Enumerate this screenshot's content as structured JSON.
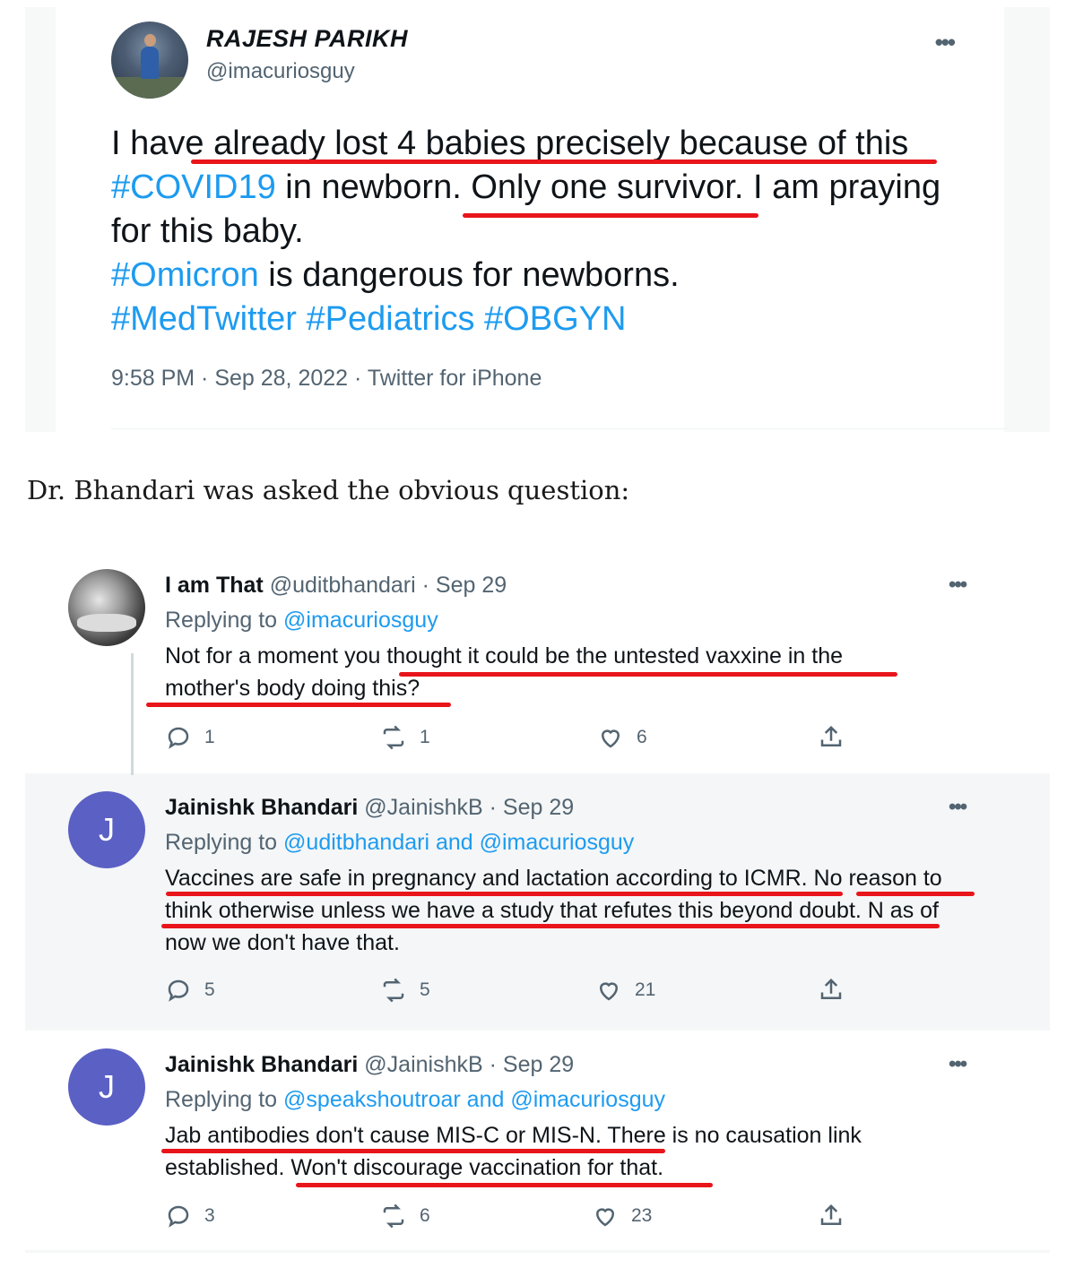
{
  "top_tweet": {
    "author_name": "RAJESH PARIKH",
    "author_handle": "@imacuriosguy",
    "more_icon": "•••",
    "text_line1": "I have already lost 4 babies precisely because of this",
    "hashtag1": "#COVID19",
    "text_line2_rest": " in newborn. Only one survivor. I am praying",
    "text_line3": "for this baby.",
    "hashtag2": "#Omicron",
    "text_line4_rest": " is dangerous for newborns.",
    "hashtags_line5": "#MedTwitter #Pediatrics #OBGYN",
    "meta": "9:58 PM · Sep 28, 2022 · Twitter for iPhone"
  },
  "paragraph": "Dr. Bhandari was asked the obvious question:",
  "thread": [
    {
      "name": "I am That",
      "handle_date": " @uditbhandari · Sep 29",
      "replying_prefix": "Replying to ",
      "replying_mentions": "@imacuriosguy",
      "text": "Not for a moment you thought it could be the untested vaxxine in the mother's body doing this?",
      "replies": "1",
      "retweets": "1",
      "likes": "6"
    },
    {
      "name": "Jainishk Bhandari",
      "avatar_letter": "J",
      "handle_date": " @JainishkB · Sep 29",
      "replying_prefix": "Replying to ",
      "replying_mentions": "@uditbhandari and @imacuriosguy",
      "text": "Vaccines are safe in pregnancy and lactation according to ICMR. No reason to think otherwise unless we have a study that refutes this beyond doubt. N as of now we don't have that.",
      "replies": "5",
      "retweets": "5",
      "likes": "21"
    },
    {
      "name": "Jainishk Bhandari",
      "avatar_letter": "J",
      "handle_date": " @JainishkB · Sep 29",
      "replying_prefix": "Replying to ",
      "replying_mentions": "@speakshoutroar and @imacuriosguy",
      "text": "Jab antibodies don't cause MIS-C or MIS-N. There is no causation link established. Won't discourage vaccination for that.",
      "replies": "3",
      "retweets": "6",
      "likes": "23"
    }
  ],
  "icons": {
    "more": "more-icon",
    "reply": "reply-icon",
    "retweet": "retweet-icon",
    "like": "heart-icon",
    "share": "share-icon"
  },
  "colors": {
    "link": "#1d9bf0",
    "underline": "#e8151b",
    "avatar_j": "#5b60c4"
  }
}
